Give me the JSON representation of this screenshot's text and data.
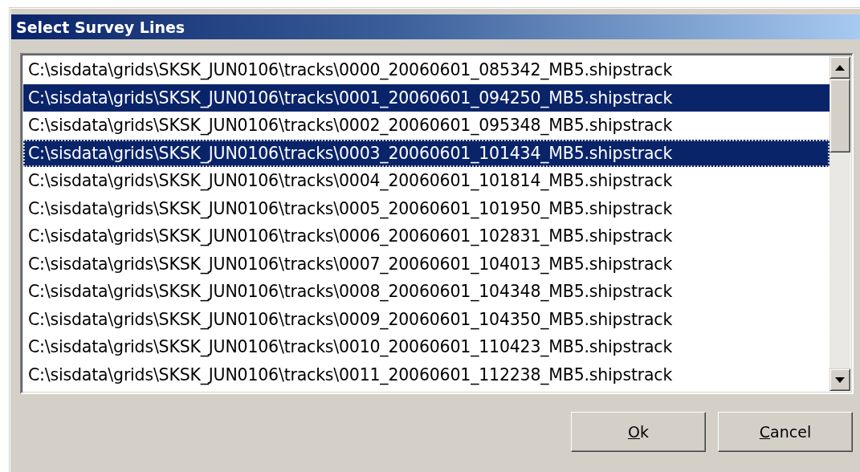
{
  "window": {
    "title": "Select Survey Lines"
  },
  "list": {
    "items": [
      {
        "text": "C:\\sisdata\\grids\\SKSK_JUN0106\\tracks\\0000_20060601_085342_MB5.shipstrack",
        "selected": false,
        "focused": false
      },
      {
        "text": "C:\\sisdata\\grids\\SKSK_JUN0106\\tracks\\0001_20060601_094250_MB5.shipstrack",
        "selected": true,
        "focused": false
      },
      {
        "text": "C:\\sisdata\\grids\\SKSK_JUN0106\\tracks\\0002_20060601_095348_MB5.shipstrack",
        "selected": false,
        "focused": false
      },
      {
        "text": "C:\\sisdata\\grids\\SKSK_JUN0106\\tracks\\0003_20060601_101434_MB5.shipstrack",
        "selected": true,
        "focused": true
      },
      {
        "text": "C:\\sisdata\\grids\\SKSK_JUN0106\\tracks\\0004_20060601_101814_MB5.shipstrack",
        "selected": false,
        "focused": false
      },
      {
        "text": "C:\\sisdata\\grids\\SKSK_JUN0106\\tracks\\0005_20060601_101950_MB5.shipstrack",
        "selected": false,
        "focused": false
      },
      {
        "text": "C:\\sisdata\\grids\\SKSK_JUN0106\\tracks\\0006_20060601_102831_MB5.shipstrack",
        "selected": false,
        "focused": false
      },
      {
        "text": "C:\\sisdata\\grids\\SKSK_JUN0106\\tracks\\0007_20060601_104013_MB5.shipstrack",
        "selected": false,
        "focused": false
      },
      {
        "text": "C:\\sisdata\\grids\\SKSK_JUN0106\\tracks\\0008_20060601_104348_MB5.shipstrack",
        "selected": false,
        "focused": false
      },
      {
        "text": "C:\\sisdata\\grids\\SKSK_JUN0106\\tracks\\0009_20060601_104350_MB5.shipstrack",
        "selected": false,
        "focused": false
      },
      {
        "text": "C:\\sisdata\\grids\\SKSK_JUN0106\\tracks\\0010_20060601_110423_MB5.shipstrack",
        "selected": false,
        "focused": false
      },
      {
        "text": "C:\\sisdata\\grids\\SKSK_JUN0106\\tracks\\0011_20060601_112238_MB5.shipstrack",
        "selected": false,
        "focused": false
      }
    ]
  },
  "buttons": [
    {
      "access_key": "O",
      "label_rest": "k"
    },
    {
      "access_key": "C",
      "label_rest": "ancel"
    }
  ]
}
